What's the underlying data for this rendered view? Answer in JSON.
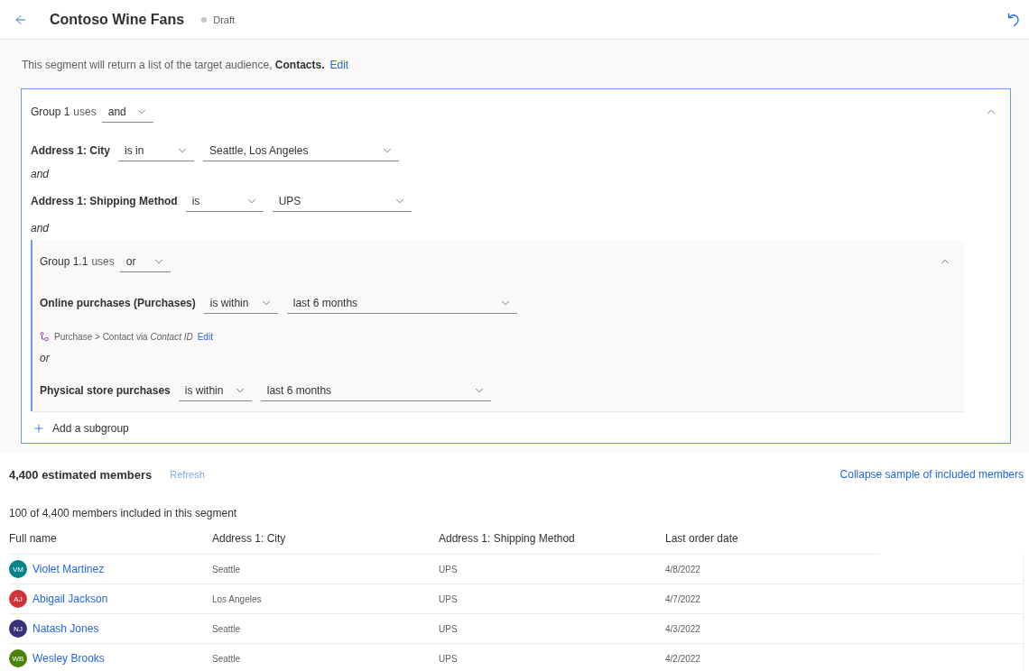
{
  "header": {
    "title": "Contoso Wine Fans",
    "status": "Draft"
  },
  "description": {
    "text": "This segment will return a list of the target audience, **Contacts.**",
    "link": "Edit"
  },
  "group": {
    "label": "Group 1",
    "uses_label": "uses",
    "operator": "and",
    "expanded": true,
    "items": [
      {
        "kind": "condition",
        "attribute": "Address 1: City",
        "operator": "is in",
        "value": "Seattle, Los Angeles"
      },
      {
        "kind": "connector",
        "text": "and"
      },
      {
        "kind": "condition",
        "attribute": "Address 1: Shipping Method",
        "operator": "is",
        "value": "UPS"
      },
      {
        "kind": "connector",
        "text": "and"
      },
      {
        "kind": "subgroup",
        "label": "Group 1.1",
        "uses_label": "uses",
        "operator": "or",
        "expanded": true,
        "items": [
          {
            "kind": "condition",
            "attribute": "Online purchases (Purchases)",
            "operator": "is within",
            "value": "last 6 months",
            "relation": {
              "text": "Purchase > Contact via *Contact ID*",
              "link": "Edit"
            }
          },
          {
            "kind": "connector",
            "text": "or"
          },
          {
            "kind": "condition",
            "attribute": "Physical store purchases",
            "operator": "is within",
            "value": "last 6 months"
          }
        ]
      }
    ],
    "add_subgroup": "Add a subgroup"
  },
  "members": {
    "estimate": "4,400 estimated members",
    "refresh": {
      "label": "Refresh",
      "disabled": true
    },
    "collapse_link": "Collapse sample of included members",
    "summary": "100 of 4,400 members included in this segment",
    "table": {
      "columns": [
        "Full name",
        "Address 1: City",
        "Address 1: Shipping Method",
        "Last order date"
      ],
      "rows": [
        {
          "initials": "VM",
          "color": "#038387",
          "name": "Violet Martinez",
          "city": "Seattle",
          "shipping": "UPS",
          "last_order": "4/8/2022"
        },
        {
          "initials": "AJ",
          "color": "#d13438",
          "name": "Abigail Jackson",
          "city": "Los Angeles",
          "shipping": "UPS",
          "last_order": "4/7/2022"
        },
        {
          "initials": "NJ",
          "color": "#373277",
          "name": "Natash Jones",
          "city": "Seattle",
          "shipping": "UPS",
          "last_order": "4/3/2022"
        },
        {
          "initials": "WB",
          "color": "#498205",
          "name": "Wesley Brooks",
          "city": "Seattle",
          "shipping": "UPS",
          "last_order": "4/2/2022"
        }
      ]
    }
  }
}
